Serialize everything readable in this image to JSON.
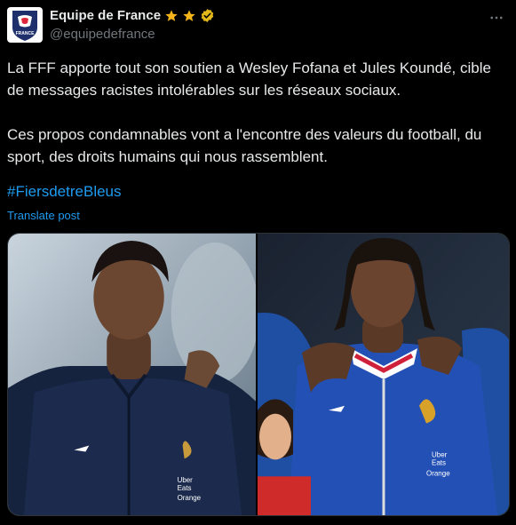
{
  "post": {
    "author": {
      "display_name": "Equipe de France",
      "handle": "@equipedefrance",
      "avatar_text": "FRANCE"
    },
    "text_paragraphs": [
      "La FFF apporte tout son soutien a Wesley Fofana et Jules Koundé, cible de messages racistes intolérables sur les réseaux sociaux.",
      "Ces propos condamnables vont a l'encontre des valeurs du football, du sport, des droits humains qui nous rassemblent."
    ],
    "hashtag": "#FiersdetreBleus",
    "translate_label": "Translate post",
    "media": [
      {
        "icon": "player-photo-left",
        "kit_text": [
          "Uber",
          "Eats",
          "Orange"
        ]
      },
      {
        "icon": "player-photo-right",
        "kit_text": [
          "Uber",
          "Eats",
          "Orange"
        ]
      }
    ]
  },
  "colors": {
    "background": "#000000",
    "text": "#e7e9ea",
    "muted": "#71767b",
    "link": "#1d9bf0",
    "star": "#f4b41a",
    "verified": "#e2b719"
  }
}
